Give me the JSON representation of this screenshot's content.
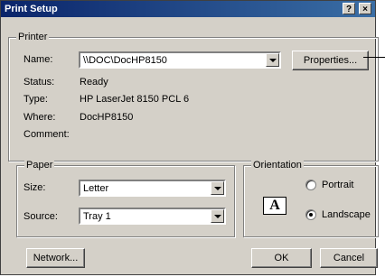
{
  "window": {
    "title": "Print Setup",
    "help": "?",
    "close": "×"
  },
  "printer": {
    "group_label": "Printer",
    "name_label": "Name:",
    "name_value": "\\\\DOC\\DocHP8150",
    "properties_label": "Properties...",
    "status_label": "Status:",
    "status_value": "Ready",
    "type_label": "Type:",
    "type_value": "HP LaserJet 8150 PCL 6",
    "where_label": "Where:",
    "where_value": "DocHP8150",
    "comment_label": "Comment:",
    "comment_value": ""
  },
  "paper": {
    "group_label": "Paper",
    "size_label": "Size:",
    "size_value": "Letter",
    "source_label": "Source:",
    "source_value": "Tray 1"
  },
  "orientation": {
    "group_label": "Orientation",
    "portrait_label": "Portrait",
    "landscape_label": "Landscape",
    "selected": "Landscape",
    "icon_letter": "A"
  },
  "footer": {
    "network_label": "Network...",
    "ok_label": "OK",
    "cancel_label": "Cancel"
  }
}
